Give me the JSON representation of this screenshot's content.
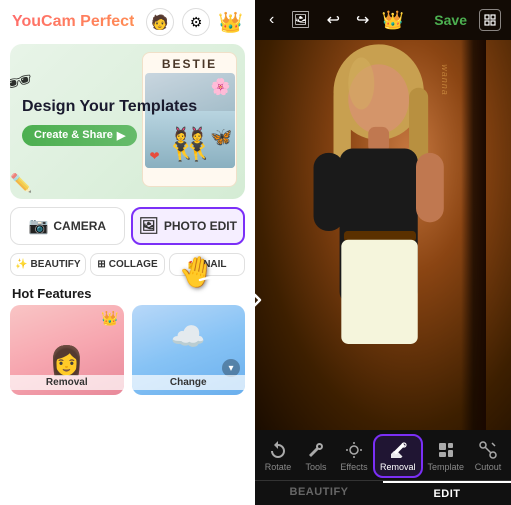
{
  "app": {
    "name": "YouCam Perfect",
    "logo_text": "YouCam Perfect"
  },
  "left": {
    "hero": {
      "title": "Design Your Templates",
      "btn_label": "Create & Share",
      "btn_arrow": "▶"
    },
    "bestie_card": {
      "title": "BESTIE"
    },
    "grid_buttons": [
      {
        "id": "camera",
        "icon": "📷",
        "label": "CAMERA",
        "active": false
      },
      {
        "id": "photo_edit",
        "icon": "🖼",
        "label": "PHOTO EDIT",
        "active": true
      }
    ],
    "bottom_buttons": [
      {
        "id": "beautify",
        "icon": "✨",
        "label": "BEAUTIFY",
        "active": false
      },
      {
        "id": "collage",
        "icon": "⊞",
        "label": "COLLAGE",
        "active": false
      },
      {
        "id": "nail",
        "icon": "💅",
        "label": "NAIL",
        "active": false
      }
    ],
    "hot_features": {
      "title": "Hot Features",
      "cards": [
        {
          "id": "removal",
          "label": "Removal"
        },
        {
          "id": "change",
          "label": "Change"
        }
      ]
    }
  },
  "right": {
    "top_bar": {
      "back_icon": "‹",
      "image_icon": "🖼",
      "undo_icon": "↩",
      "redo_icon": "↪",
      "crown_icon": "👑",
      "save_label": "Save",
      "grid_icon": "⊞"
    },
    "wall_text": "wanna",
    "tools": [
      {
        "id": "rotate",
        "icon": "🔄",
        "label": "Rotate"
      },
      {
        "id": "tools",
        "icon": "🔧",
        "label": "Tools"
      },
      {
        "id": "effects",
        "icon": "✨",
        "label": "Effects"
      },
      {
        "id": "removal",
        "icon": "✂",
        "label": "Removal",
        "active": true
      },
      {
        "id": "template",
        "icon": "📋",
        "label": "Template"
      },
      {
        "id": "cutout",
        "icon": "✂",
        "label": "Cutout"
      }
    ],
    "tabs": [
      {
        "id": "beautify",
        "label": "BEAUTIFY",
        "active": false
      },
      {
        "id": "edit",
        "label": "EDIT",
        "active": true
      }
    ]
  },
  "overlay": {
    "hand_pointer": "👆",
    "arrow_desc": "curved arrow pointing from left panel to right panel"
  }
}
